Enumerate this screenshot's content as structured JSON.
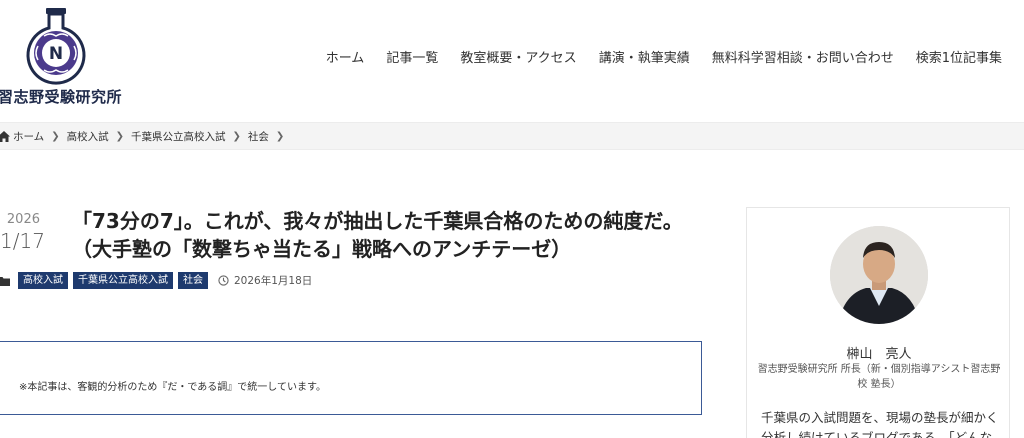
{
  "site": {
    "title": "習志野受験研究所",
    "logo_letter": "N"
  },
  "nav": {
    "items": [
      "ホーム",
      "記事一覧",
      "教室概要・アクセス",
      "講演・執筆実績",
      "無料科学習相談・お問い合わせ",
      "検索1位記事集"
    ]
  },
  "breadcrumb": {
    "items": [
      "ホーム",
      "高校入試",
      "千葉県公立高校入試",
      "社会"
    ]
  },
  "article": {
    "date_year": "2026",
    "date_md": "1/17",
    "title_line1": "「73分の7」。これが、我々が抽出した千葉県合格のための純度だ。",
    "title_line2": "（大手塾の「数撃ちゃ当たる」戦略へのアンチテーゼ）",
    "tags": [
      "高校入試",
      "千葉県公立高校入試",
      "社会"
    ],
    "published": "2026年1月18日",
    "notice": "※本記事は、客観的分析のため『だ・である調』で統一しています。"
  },
  "sidebar": {
    "name": "榊山　亮人",
    "role": "習志野受験研究所 所長（新・個別指導アシスト習志野校 塾長）",
    "bio": "千葉県の入試問題を、現場の塾長が細かく分析し続けているブログである。「どんな"
  },
  "colors": {
    "brand_navy": "#1e3a6e",
    "notice_border": "#3b5a96",
    "logo_purple": "#4b3a8c"
  }
}
